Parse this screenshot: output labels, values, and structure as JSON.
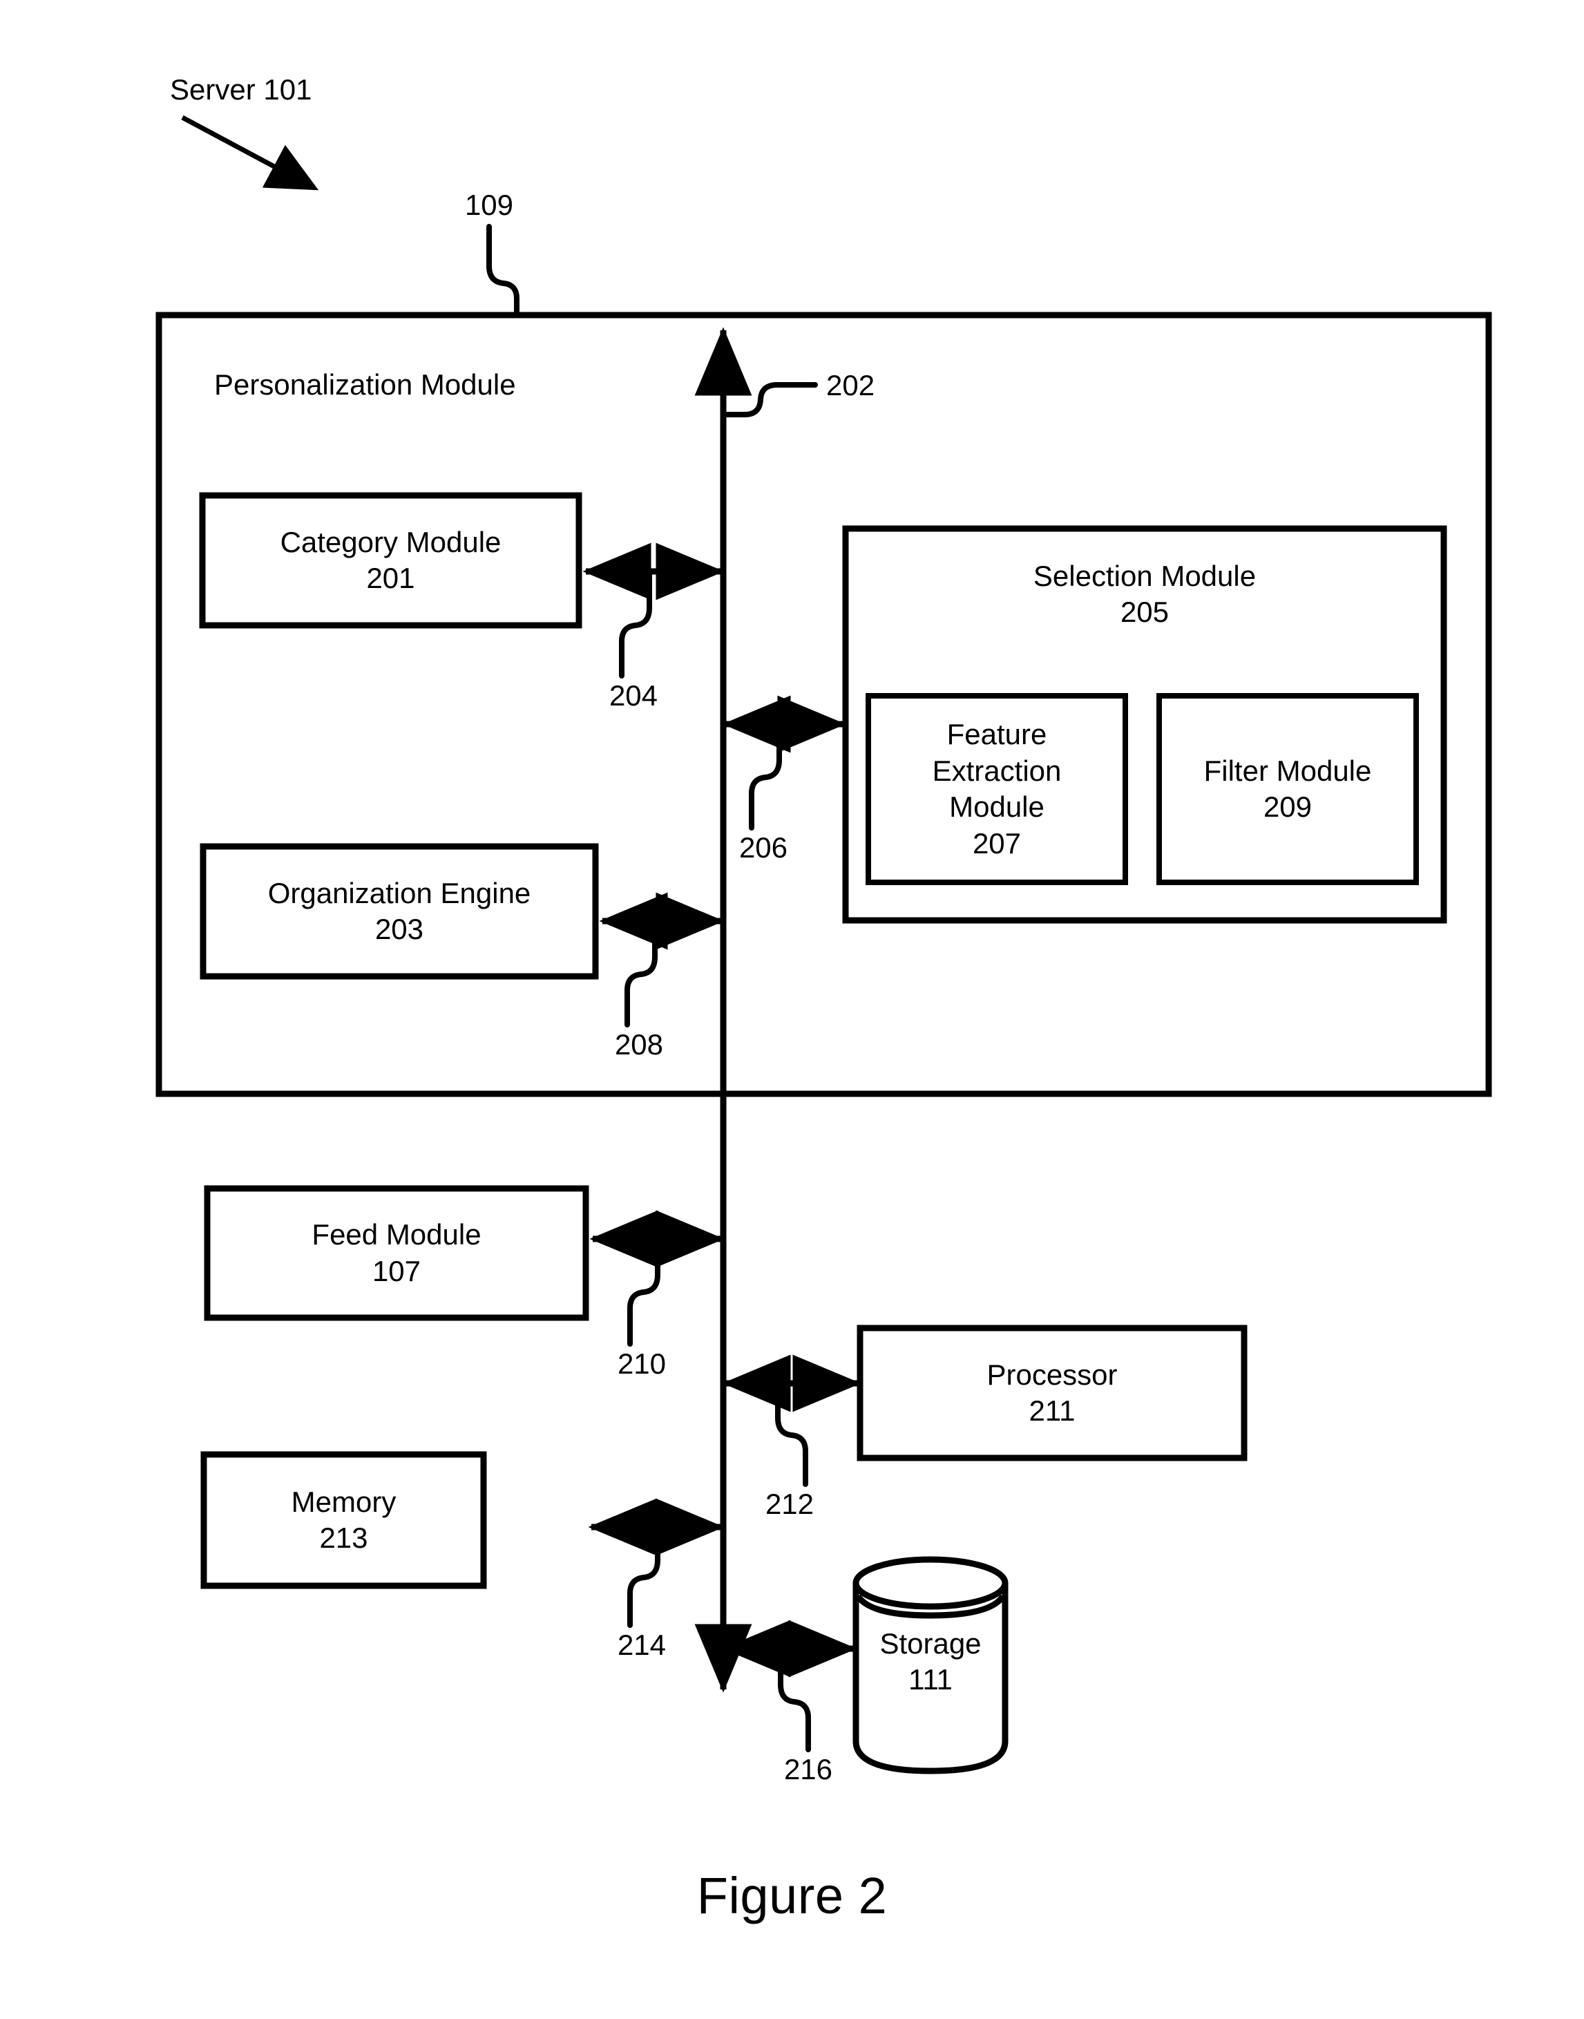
{
  "figure": {
    "caption": "Figure 2",
    "server_label": "Server 101",
    "bus_ref": "109",
    "container_title": "Personalization Module"
  },
  "refs": {
    "r202": "202",
    "r204": "204",
    "r206": "206",
    "r208": "208",
    "r210": "210",
    "r212": "212",
    "r214": "214",
    "r216": "216"
  },
  "blocks": {
    "category_module": {
      "name": "Category Module",
      "number": "201"
    },
    "organization_engine": {
      "name": "Organization Engine",
      "number": "203"
    },
    "selection_module": {
      "name": "Selection Module",
      "number": "205"
    },
    "feature_extraction_module": {
      "name": "Feature\nExtraction\nModule",
      "number": "207"
    },
    "filter_module": {
      "name": "Filter Module",
      "number": "209"
    },
    "feed_module": {
      "name": "Feed Module",
      "number": "107"
    },
    "processor": {
      "name": "Processor",
      "number": "211"
    },
    "memory": {
      "name": "Memory",
      "number": "213"
    },
    "storage": {
      "name": "Storage",
      "number": "111"
    }
  },
  "colors": {
    "stroke": "#000000",
    "background": "#ffffff"
  }
}
